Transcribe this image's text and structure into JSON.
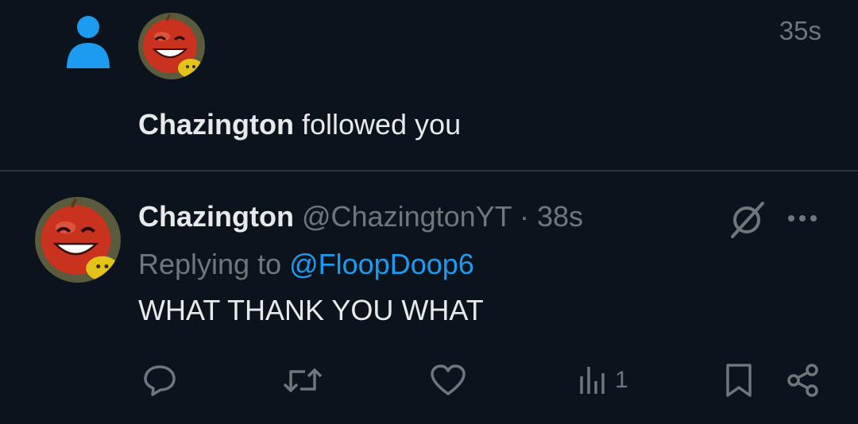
{
  "notification": {
    "time": "35s",
    "actor": "Chazington",
    "action_text": " followed you"
  },
  "tweet": {
    "display_name": "Chazington",
    "handle": "@ChazingtonYT",
    "separator": " · ",
    "time": "38s",
    "replying_prefix": "Replying to ",
    "replying_to": "@FloopDoop6",
    "text": "WHAT THANK YOU WHAT",
    "views_count": "1"
  },
  "colors": {
    "background": "#0b141c",
    "accent": "#1d9bf0",
    "secondary_text": "#71767b",
    "primary_text": "#e7e9ea"
  },
  "icons": {
    "follow": "person-icon",
    "grok": "grok-icon",
    "more": "more-icon",
    "reply": "reply-icon",
    "retweet": "retweet-icon",
    "like": "heart-icon",
    "views": "views-icon",
    "bookmark": "bookmark-icon",
    "share": "share-icon"
  }
}
